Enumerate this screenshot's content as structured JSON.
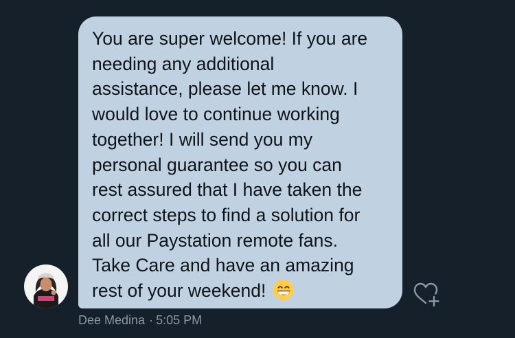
{
  "message": {
    "lines": [
      "You are super welcome! If you are",
      "needing any additional",
      "assistance, please let me know. I",
      "would love to continue working",
      "together! I will send you my",
      "personal guarantee so you can",
      "rest assured that I have taken the",
      "correct steps to find a solution for",
      "all our Paystation remote fans.",
      "Take Care and have an amazing",
      "rest of your weekend!"
    ],
    "emoji": "grinning-face-with-smiling-eyes"
  },
  "sender": {
    "name": "Dee Medina",
    "separator": "·",
    "time": "5:05 PM"
  },
  "icons": {
    "like": "heart-plus-icon",
    "avatar": "profile-photo"
  },
  "colors": {
    "background": "#15202b",
    "bubble": "#c0d2e1",
    "text": "#0f1419",
    "meta": "#8b98a5"
  }
}
